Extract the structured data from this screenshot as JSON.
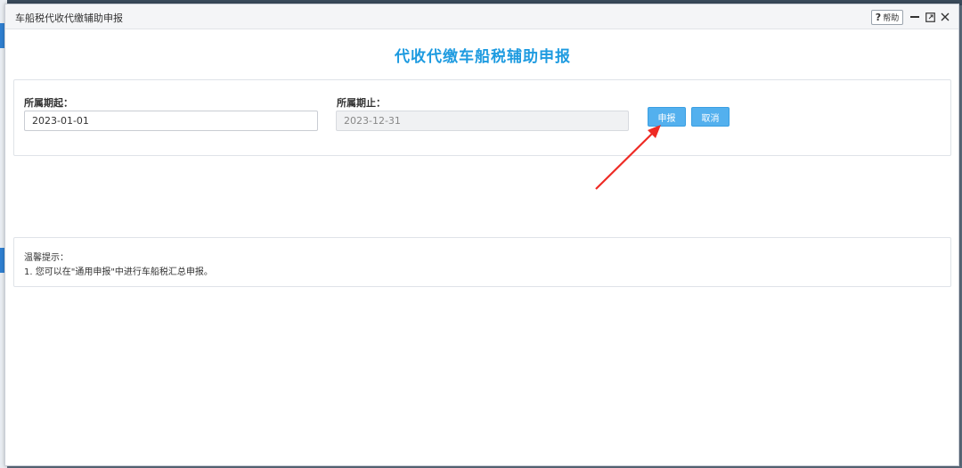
{
  "window": {
    "title": "车船税代收代缴辅助申报",
    "help_label": "帮助",
    "help_glyph": "?"
  },
  "page": {
    "heading": "代收代缴车船税辅助申报",
    "heading_color": "#1e9be0"
  },
  "form": {
    "start_label": "所属期起：",
    "start_value": "2023-01-01",
    "end_label": "所属期止：",
    "end_value": "2023-12-31",
    "submit_label": "申报",
    "cancel_label": "取消",
    "button_color": "#53b0ee"
  },
  "tips": {
    "title": "温馨提示：",
    "items": [
      "1. 您可以在\"通用申报\"中进行车船税汇总申报。"
    ]
  },
  "annotation": {
    "arrow_color": "#ee2a24"
  }
}
